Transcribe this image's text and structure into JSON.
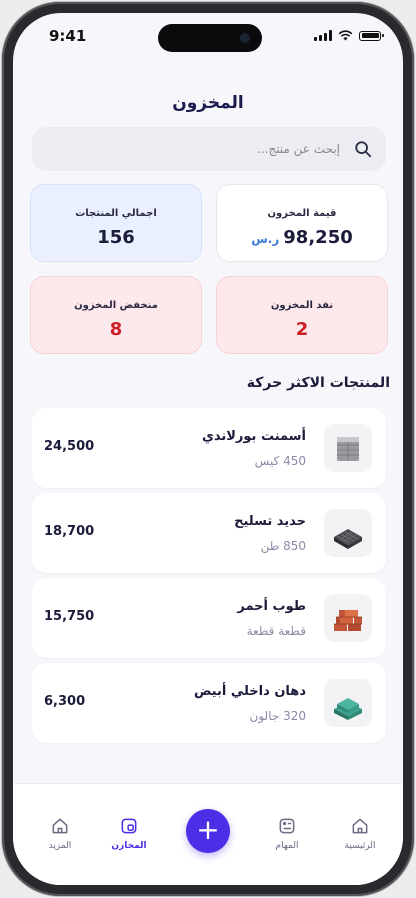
{
  "status_bar": {
    "time": "9:41"
  },
  "header": {
    "title": "المخزون"
  },
  "search": {
    "placeholder": "إبحث عن منتج..."
  },
  "stats": {
    "stock_value": {
      "label": "قيمة المخزون",
      "value": "98,250",
      "currency": "ر.س"
    },
    "total_products": {
      "label": "اجمالي المنتجات",
      "value": "156"
    },
    "out_of_stock": {
      "label": "نفد المخزون",
      "value": "2"
    },
    "low_stock": {
      "label": "منخفض المخزون",
      "value": "8"
    }
  },
  "section_title": "المنتجات الاكثر حركة",
  "products": [
    {
      "name": "أسمنت بورلاندي",
      "qty": "450 كيس",
      "amount": "24,500",
      "icon": "cement-bags-icon"
    },
    {
      "name": "حديد تسليح",
      "qty": "850 طن",
      "amount": "18,700",
      "icon": "steel-rebar-icon"
    },
    {
      "name": "طوب أحمر",
      "qty": "قطعة قطعة",
      "amount": "15,750",
      "icon": "red-bricks-icon"
    },
    {
      "name": "دهان داخلي أبيض",
      "qty": "320 جالون",
      "amount": "6,300",
      "icon": "paint-cans-icon"
    }
  ],
  "tabs": {
    "home": "الرئيسية",
    "tasks": "المهام",
    "add": "+",
    "inventory": "المخازن",
    "more": "المزيد"
  },
  "colors": {
    "accent": "#4b2fe6",
    "danger": "#cc2027",
    "heading": "#1b1b4d"
  }
}
